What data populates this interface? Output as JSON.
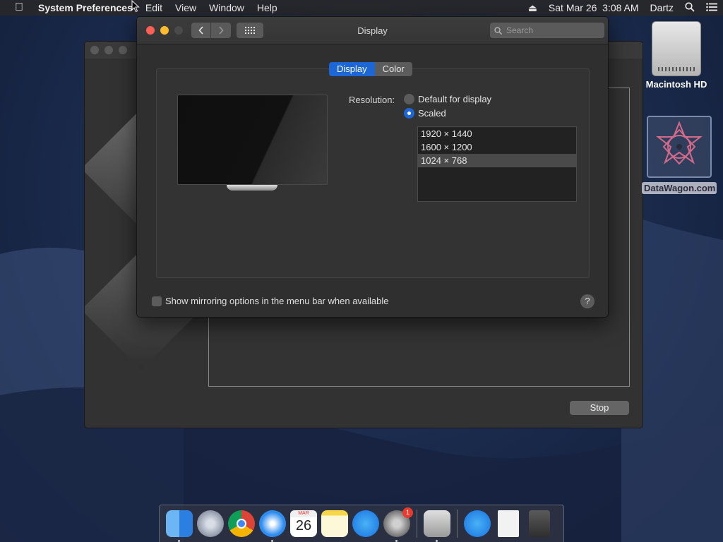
{
  "menubar": {
    "app_name": "System Preferences",
    "menus": [
      "Edit",
      "View",
      "Window",
      "Help"
    ],
    "clock": "Sat Mar 26  3:08 AM",
    "user": "Dartz",
    "icons": [
      "apple-icon",
      "eject-icon",
      "spotlight-icon",
      "notification-center-icon"
    ]
  },
  "window": {
    "title": "Display",
    "search_placeholder": "Search",
    "tabs": [
      {
        "label": "Display",
        "active": true
      },
      {
        "label": "Color",
        "active": false
      }
    ],
    "resolution_label": "Resolution:",
    "resolution_options": [
      {
        "label": "Default for display",
        "selected": false
      },
      {
        "label": "Scaled",
        "selected": true
      }
    ],
    "resolutions": [
      {
        "label": "1920 × 1440",
        "selected": false
      },
      {
        "label": "1600 × 1200",
        "selected": false
      },
      {
        "label": "1024 × 768",
        "selected": true
      }
    ],
    "mirroring_label": "Show mirroring options in the menu bar when available",
    "mirroring_checked": false,
    "help_label": "?"
  },
  "background_window": {
    "stop_label": "Stop"
  },
  "desktop": {
    "icons": [
      {
        "label": "Macintosh HD",
        "icon": "hard-drive-icon"
      },
      {
        "label": "DataWagon.com",
        "icon": "datawagon-icon"
      }
    ]
  },
  "dock": {
    "calendar_month": "MAR",
    "calendar_day": "26",
    "prefs_badge": "1",
    "items": [
      "finder",
      "launchpad",
      "chrome",
      "safari",
      "calendar",
      "notes",
      "app-store",
      "system-preferences",
      "boot-camp-assistant",
      "app-store-downloads",
      "document",
      "trash"
    ]
  },
  "colors": {
    "accent": "#1d66d6",
    "close": "#fe5f57",
    "minimize": "#febc2e",
    "window_bg": "#2f2f2f"
  }
}
